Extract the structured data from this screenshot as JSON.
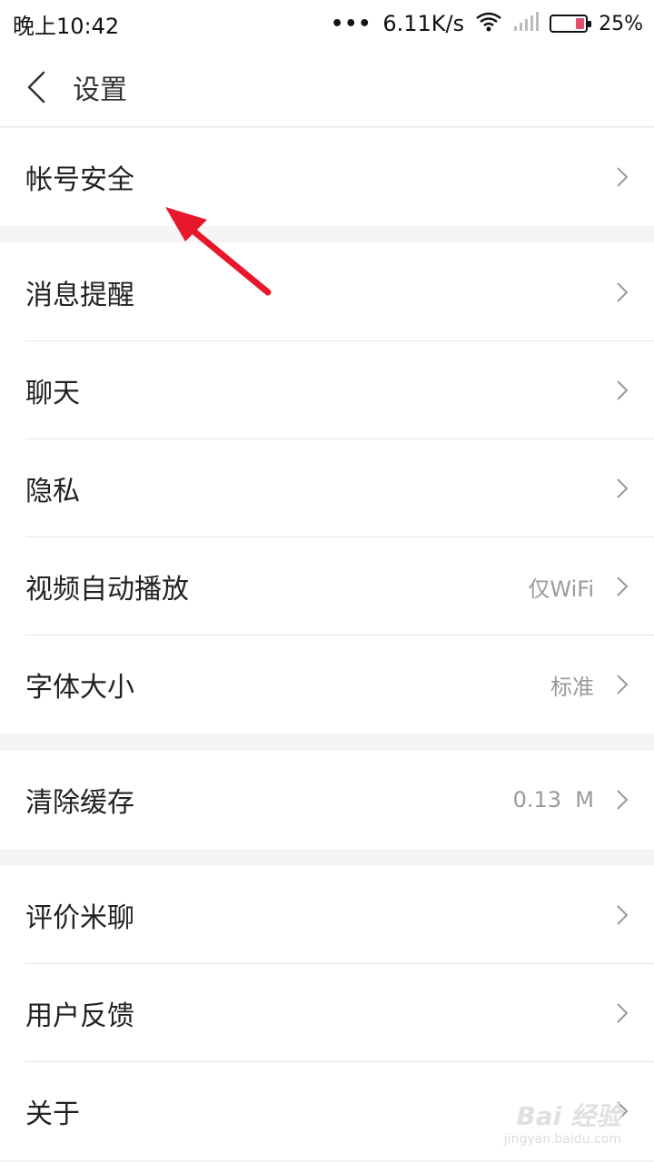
{
  "status_bar": {
    "time": "晚上10:42",
    "signal_dots": "•••",
    "net_speed": "6.11K/s",
    "battery_percent": "25%",
    "battery_level": 0.25,
    "icons": [
      "wifi-icon",
      "signal-icon",
      "battery-icon"
    ]
  },
  "header": {
    "title": "设置",
    "back_icon": "back-arrow-icon"
  },
  "groups": [
    {
      "items": [
        {
          "label": "帐号安全",
          "value": ""
        }
      ]
    },
    {
      "items": [
        {
          "label": "消息提醒",
          "value": ""
        },
        {
          "label": "聊天",
          "value": ""
        },
        {
          "label": "隐私",
          "value": ""
        },
        {
          "label": "视频自动播放",
          "value": "仅WiFi"
        },
        {
          "label": "字体大小",
          "value": "标准"
        }
      ]
    },
    {
      "items": [
        {
          "label": "清除缓存",
          "value": "0.13  M"
        }
      ]
    },
    {
      "items": [
        {
          "label": "评价米聊",
          "value": ""
        },
        {
          "label": "用户反馈",
          "value": ""
        },
        {
          "label": "关于",
          "value": ""
        }
      ]
    }
  ],
  "watermark": {
    "brand": "Bai 经验",
    "url": "jingyan.baidu.com"
  },
  "colors": {
    "annotation_arrow": "#e8182c",
    "background": "#f5f5f5",
    "card": "#ffffff"
  }
}
